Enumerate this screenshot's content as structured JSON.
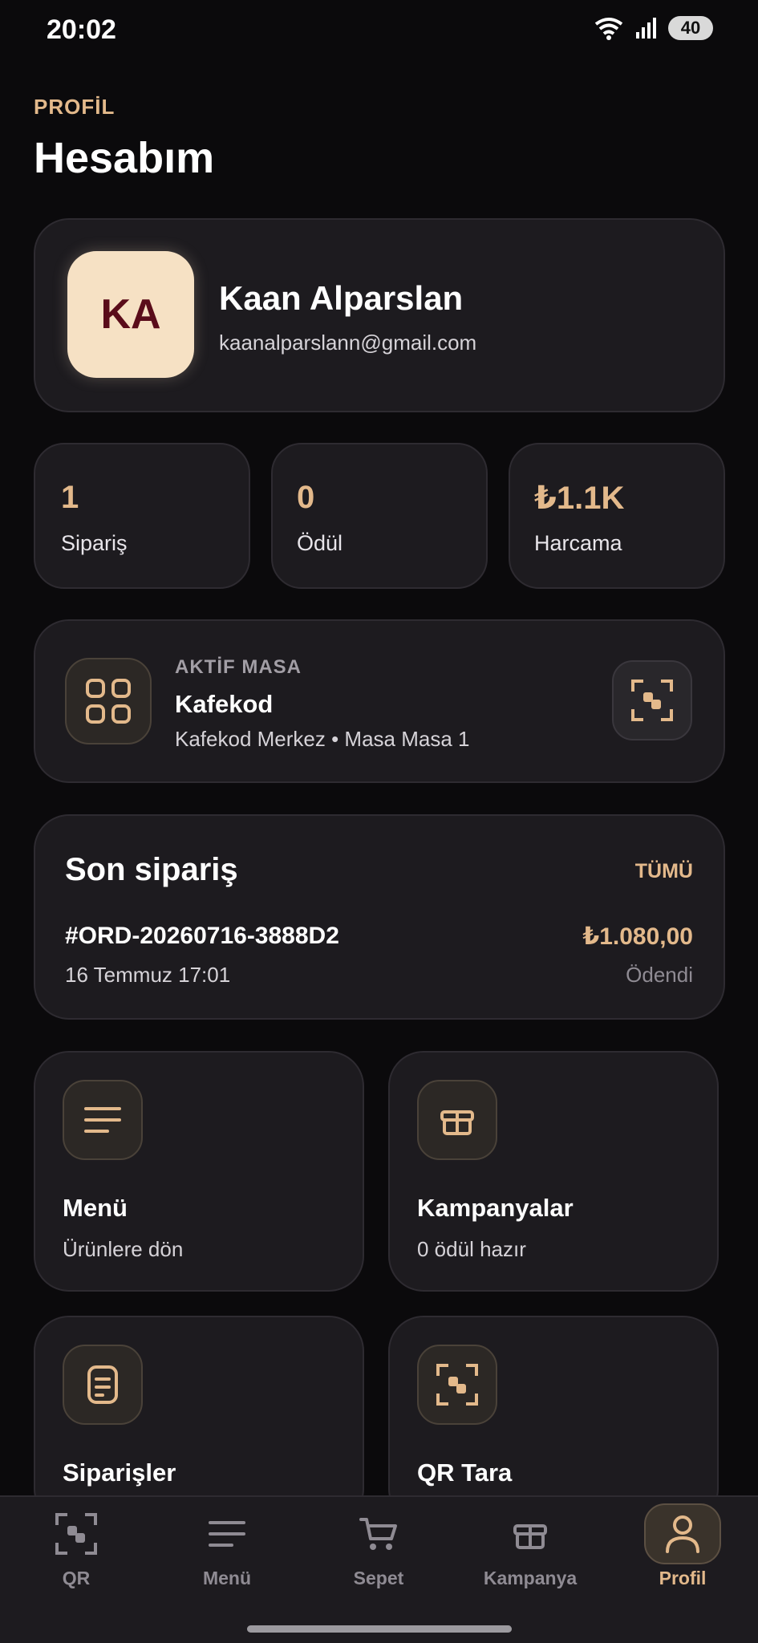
{
  "status_bar": {
    "time": "20:02",
    "battery": "40"
  },
  "header": {
    "section": "PROFİL",
    "title": "Hesabım"
  },
  "profile": {
    "initials": "KA",
    "name": "Kaan Alparslan",
    "email": "kaanalparslann@gmail.com"
  },
  "stats": [
    {
      "value": "1",
      "label": "Sipariş"
    },
    {
      "value": "0",
      "label": "Ödül"
    },
    {
      "value": "₺1.1K",
      "label": "Harcama"
    }
  ],
  "active_table": {
    "label": "AKTİF MASA",
    "name": "Kafekod",
    "detail": "Kafekod Merkez • Masa Masa 1"
  },
  "last_order": {
    "title": "Son sipariş",
    "view_all": "TÜMÜ",
    "id": "#ORD-20260716-3888D2",
    "amount": "₺1.080,00",
    "date": "16 Temmuz 17:01",
    "status": "Ödendi"
  },
  "quick_links": [
    {
      "title": "Menü",
      "subtitle": "Ürünlere dön",
      "icon": "menu-lines-icon"
    },
    {
      "title": "Kampanyalar",
      "subtitle": "0 ödül hazır",
      "icon": "gift-icon"
    },
    {
      "title": "Siparişler",
      "subtitle": "",
      "icon": "document-icon"
    },
    {
      "title": "QR Tara",
      "subtitle": "",
      "icon": "qr-scan-icon"
    }
  ],
  "bottom_nav": [
    {
      "label": "QR",
      "icon": "qr-scan-icon",
      "active": false
    },
    {
      "label": "Menü",
      "icon": "menu-lines-icon",
      "active": false
    },
    {
      "label": "Sepet",
      "icon": "cart-icon",
      "active": false
    },
    {
      "label": "Kampanya",
      "icon": "gift-icon",
      "active": false
    },
    {
      "label": "Profil",
      "icon": "user-icon",
      "active": true
    }
  ],
  "colors": {
    "accent": "#e3b98b",
    "background": "#0b0a0c",
    "card": "#1d1b1f",
    "avatar_bg": "#f6e1c4",
    "avatar_text": "#5a0c1a"
  }
}
